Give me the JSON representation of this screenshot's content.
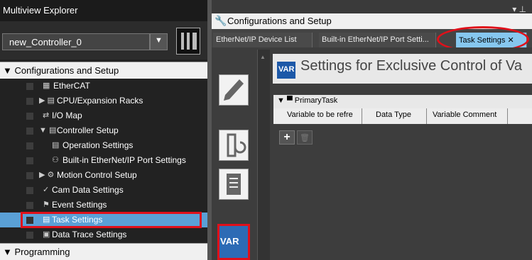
{
  "explorer": {
    "title": "Multiview Explorer",
    "pin_icon": "pin-icon",
    "controller": "new_Controller_0",
    "config_section": "▼ Configurations and Setup",
    "items": [
      {
        "label": "EtherCAT",
        "icon": "ethercat-icon",
        "glyph": "▦"
      },
      {
        "label": "CPU/Expansion Racks",
        "icon": "rack-icon",
        "glyph": "▶ ▤"
      },
      {
        "label": "I/O Map",
        "icon": "io-map-icon",
        "glyph": "⇄"
      },
      {
        "label": "Controller Setup",
        "icon": "controller-setup-icon",
        "glyph": "▼ ▤"
      },
      {
        "label": "Operation Settings",
        "icon": "settings-icon",
        "glyph": "▤"
      },
      {
        "label": "Built-in EtherNet/IP Port Settings",
        "icon": "network-icon",
        "glyph": "⚇"
      },
      {
        "label": "Motion Control Setup",
        "icon": "motion-icon",
        "glyph": "▶ ⚙"
      },
      {
        "label": "Cam Data Settings",
        "icon": "cam-icon",
        "glyph": "✓"
      },
      {
        "label": "Event Settings",
        "icon": "flag-icon",
        "glyph": "⚑"
      },
      {
        "label": "Task Settings",
        "icon": "task-icon",
        "glyph": "▤"
      },
      {
        "label": "Data Trace Settings",
        "icon": "trace-icon",
        "glyph": "▣"
      }
    ],
    "programming_section": "▼ Programming"
  },
  "editor": {
    "window_title": "Configurations and Setup",
    "tabs": [
      "EtherNet/IP Device List",
      "Built-in EtherNet/IP Port Setti...",
      "Task Settings ✕"
    ],
    "var_badge": "VAR",
    "title": "Settings for Exclusive Control of Va",
    "primary_task": "▼ ▀ PrimaryTask",
    "columns": [
      "Variable to be refre",
      "Data Type",
      "Variable Comment"
    ],
    "add_label": "+",
    "delete_label": "🗑",
    "side_var_label": "VAR"
  },
  "colors": {
    "highlight": "#e0101a",
    "selected": "#5aa0d6",
    "accent": "#1c58a8"
  }
}
